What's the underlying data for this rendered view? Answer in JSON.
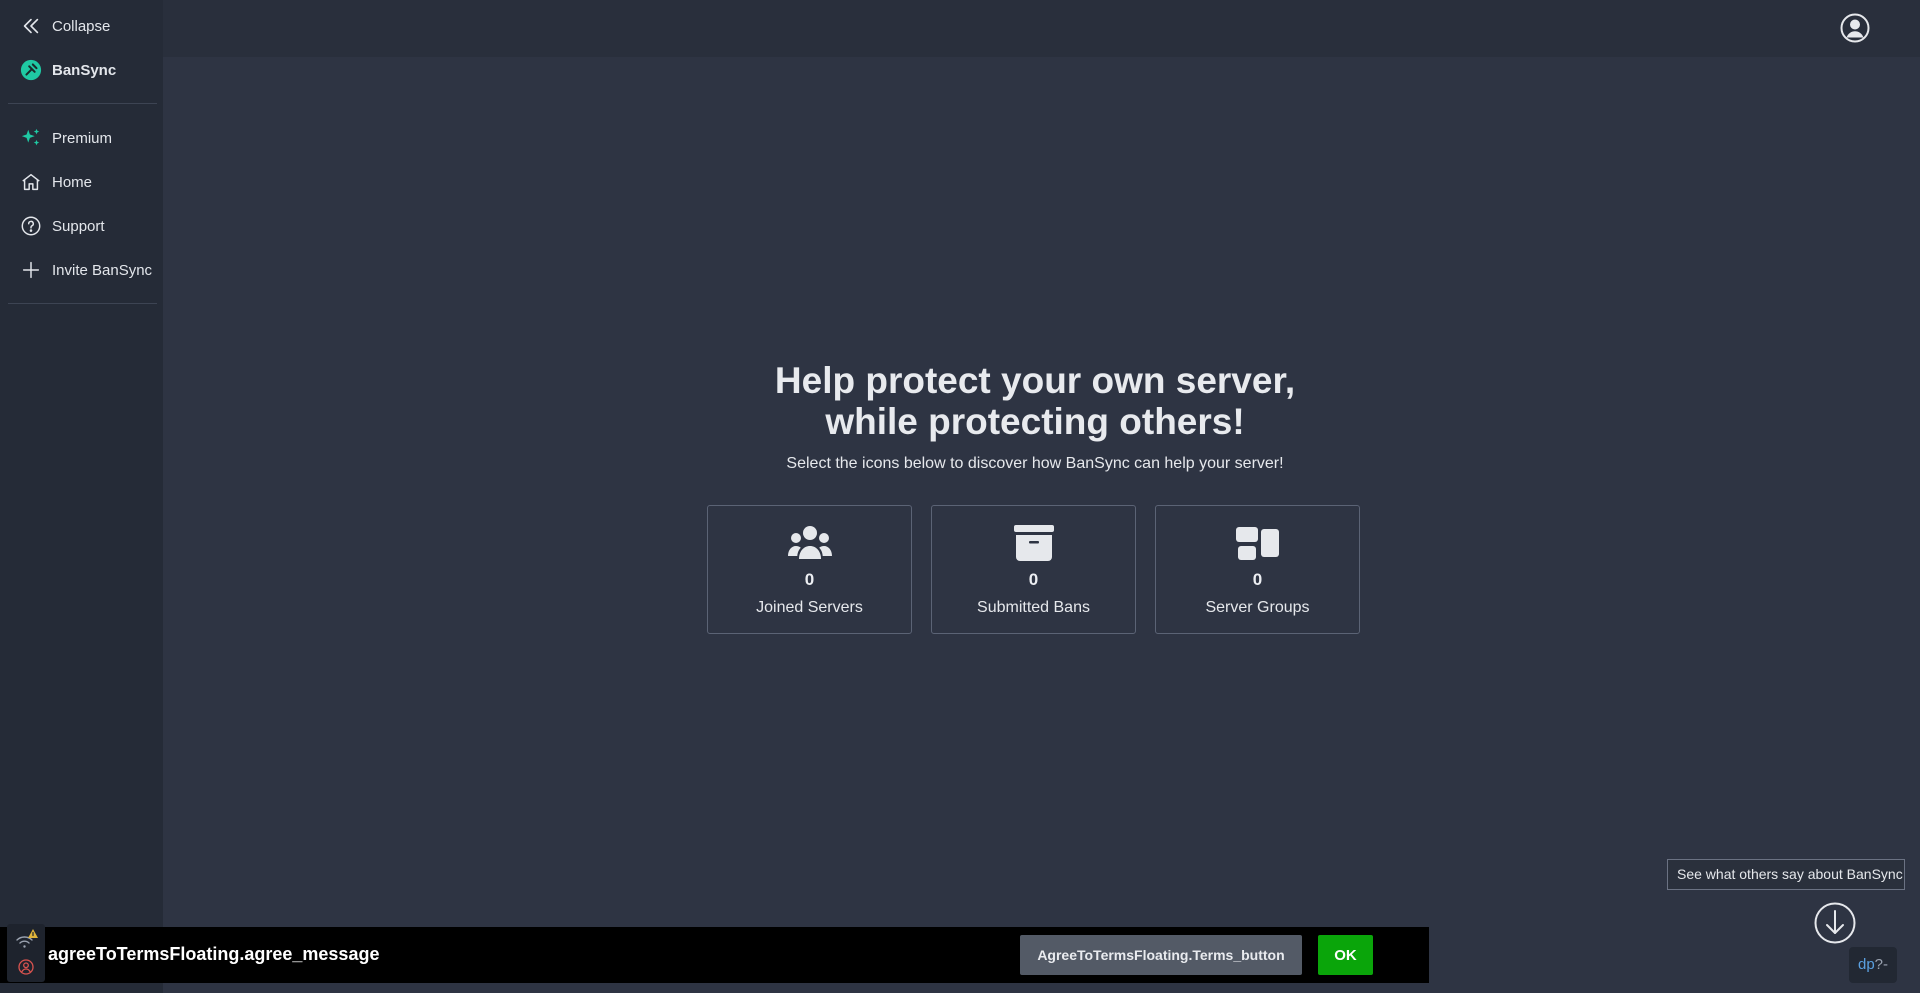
{
  "sidebar": {
    "collapse_label": "Collapse",
    "brand": "BanSync",
    "items": [
      {
        "label": "Premium",
        "icon": "sparkles-icon"
      },
      {
        "label": "Home",
        "icon": "home-icon"
      },
      {
        "label": "Support",
        "icon": "help-circle-icon"
      },
      {
        "label": "Invite BanSync",
        "icon": "plus-icon"
      }
    ]
  },
  "hero": {
    "title_line1": "Help protect your own server,",
    "title_line2": "while protecting others!",
    "subtitle": "Select the icons below to discover how BanSync can help your server!"
  },
  "stats": [
    {
      "value": "0",
      "label": "Joined Servers",
      "icon": "users-icon"
    },
    {
      "value": "0",
      "label": "Submitted Bans",
      "icon": "archive-icon"
    },
    {
      "value": "0",
      "label": "Server Groups",
      "icon": "groups-icon"
    }
  ],
  "reviews": {
    "text": "See what others say about BanSync"
  },
  "agree_bar": {
    "message": "agreeToTermsFloating.agree_message",
    "terms_button": "AgreeToTermsFloating.Terms_button",
    "ok_button": "OK"
  },
  "dp_badge": {
    "brand": "dp",
    "suffix": "?-"
  },
  "colors": {
    "background": "#2e3443",
    "sidebar": "#252b37",
    "accent": "#1fc9a3",
    "ok_green": "#0aa50a"
  }
}
